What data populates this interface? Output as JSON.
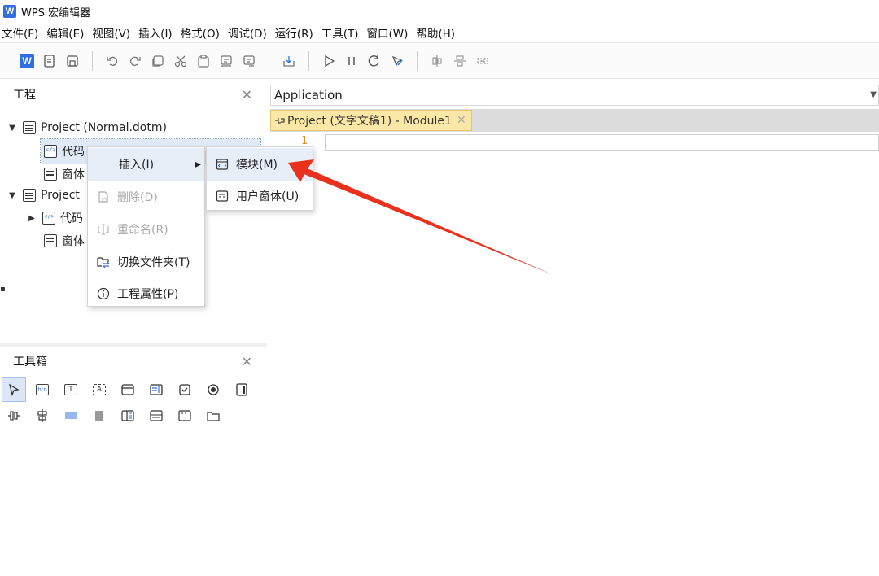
{
  "app": {
    "logo_letter": "W",
    "title": "WPS 宏编辑器"
  },
  "menu": [
    "文件(F)",
    "编辑(E)",
    "视图(V)",
    "插入(I)",
    "格式(O)",
    "调试(D)",
    "运行(R)",
    "工具(T)",
    "窗口(W)",
    "帮助(H)"
  ],
  "toolbar": {
    "word_icon_letter": "W",
    "icons": [
      "word-icon",
      "module-insert-icon",
      "save-icon",
      "undo-icon",
      "redo-icon",
      "copy-window-icon",
      "cut-icon",
      "paste-icon",
      "comment-icon",
      "uncomment-icon",
      "export-icon",
      "run-icon",
      "pause-icon",
      "reset-icon",
      "design-mode-icon",
      "align-vertical-icon",
      "align-horizontal-icon",
      "distribute-icon"
    ]
  },
  "project_panel": {
    "title": "工程",
    "close_glyph": "✕",
    "tree": [
      {
        "label": "Project (Normal.dotm)",
        "icon": "project-icon",
        "expanded": true,
        "arrow": "▼"
      },
      {
        "label": "代码",
        "icon": "code-icon"
      },
      {
        "label": "窗体",
        "icon": "form-icon"
      },
      {
        "label": "Project",
        "icon": "project-icon",
        "expanded": true,
        "arrow": "▼"
      },
      {
        "label": "代码",
        "icon": "code-icon",
        "arrow": "▶"
      },
      {
        "label": "窗体",
        "icon": "form-icon"
      }
    ]
  },
  "toolbox_panel": {
    "title": "工具箱",
    "close_glyph": "✕",
    "tools": [
      "pointer-tool",
      "button-tool",
      "textbox-tool",
      "label-tool",
      "frame-tool",
      "listbox-tool",
      "checkbox-tool",
      "radio-tool",
      "toggle-tool",
      "spin-tool",
      "scroll-tool",
      "hscroll-tool",
      "vscroll-tool",
      "multipage-tool",
      "combo-tool",
      "image-tool",
      "tabstrip-tool"
    ]
  },
  "editor": {
    "object_dropdown": "Application",
    "tab_label": "Project (文字文稿1) - Module1",
    "tab_close": "✕",
    "line_number": "1"
  },
  "context_menu": {
    "items": [
      {
        "label": "插入(I)",
        "disabled": false,
        "has_submenu": true
      },
      {
        "label": "删除(D)",
        "disabled": true
      },
      {
        "label": "重命名(R)",
        "disabled": true
      },
      {
        "label": "切换文件夹(T)",
        "disabled": false
      },
      {
        "label": "工程属性(P)",
        "disabled": false
      }
    ]
  },
  "submenu": {
    "items": [
      {
        "label": "模块(M)"
      },
      {
        "label": "用户窗体(U)"
      }
    ]
  },
  "annotation": {
    "color": "#e8321e"
  }
}
